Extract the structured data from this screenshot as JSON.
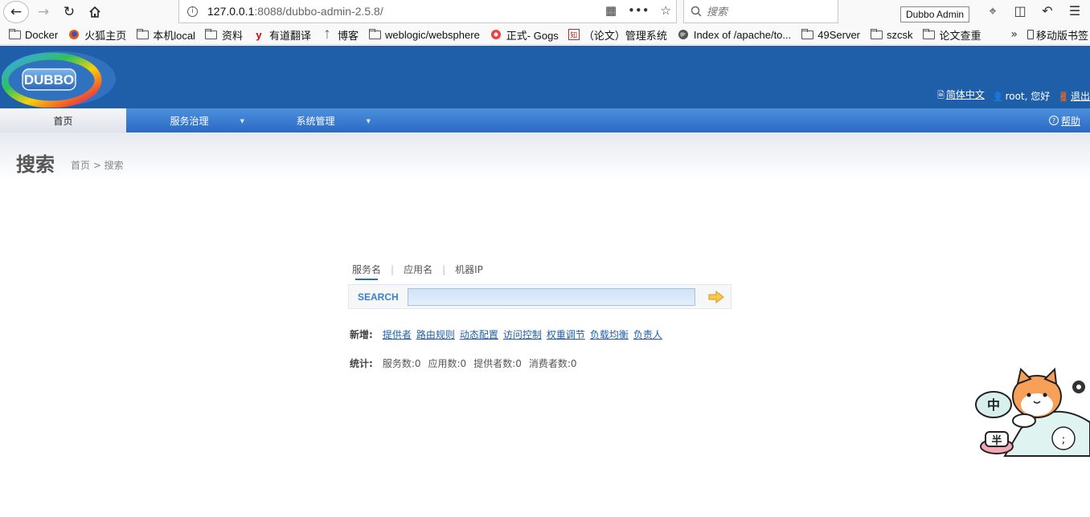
{
  "browser": {
    "url_host": "127.0.0.1",
    "url_rest": ":8088/dubbo-admin-2.5.8/",
    "search_placeholder": "搜索",
    "tooltip": "Dubbo Admin",
    "bookmarks": [
      "Docker",
      "火狐主页",
      "本机local",
      "资料",
      "有道翻译",
      "博客",
      "weblogic/websphere",
      "正式- Gogs",
      "（论文）管理系统",
      "Index of /apache/to...",
      "49Server",
      "szcsk",
      "论文查重"
    ],
    "mobile_bookmarks": "移动版书签"
  },
  "header": {
    "logo_text": "DUBBO",
    "language": "简体中文",
    "greeting": "root, 您好",
    "logout": "退出"
  },
  "menu": {
    "home": "首页",
    "services": "服务治理",
    "system": "系统管理",
    "help": "帮助"
  },
  "page": {
    "title": "搜索",
    "breadcrumb": "首页 > 搜索"
  },
  "search": {
    "tabs": [
      "服务名",
      "应用名",
      "机器IP"
    ],
    "label": "SEARCH",
    "value": ""
  },
  "new": {
    "label": "新增:",
    "links": [
      "提供者",
      "路由规则",
      "动态配置",
      "访问控制",
      "权重调节",
      "负载均衡",
      "负责人"
    ]
  },
  "stats": {
    "label": "统计:",
    "items": [
      "服务数:0",
      "应用数:0",
      "提供者数:0",
      "消费者数:0"
    ]
  },
  "mascot": {
    "left_badge": "中",
    "bowl_badge": "半"
  }
}
